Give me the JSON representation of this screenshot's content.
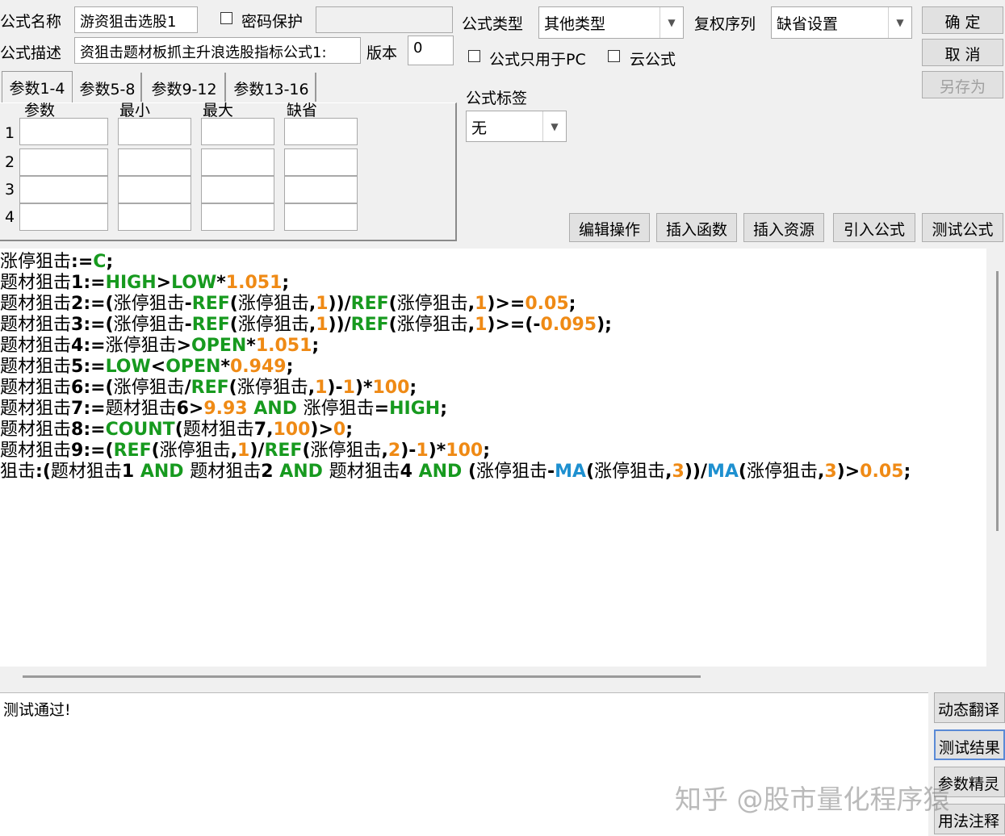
{
  "top": {
    "name_label": "公式名称",
    "name_value": "游资狙击选股1",
    "password_label": "密码保护",
    "desc_label": "公式描述",
    "desc_value": "资狙击题材板抓主升浪选股指标公式1:",
    "version_label": "版本",
    "version_value": "0",
    "type_label": "公式类型",
    "type_value": "其他类型",
    "fq_label": "复权序列",
    "fq_value": "缺省设置",
    "pc_only_label": "公式只用于PC",
    "cloud_label": "云公式",
    "tag_label": "公式标签",
    "tag_value": "无"
  },
  "buttons": {
    "ok": "确 定",
    "cancel": "取 消",
    "save_as": "另存为",
    "edit_ops": "编辑操作",
    "insert_func": "插入函数",
    "insert_res": "插入资源",
    "import_formula": "引入公式",
    "test_formula": "测试公式"
  },
  "params": {
    "tabs": [
      "参数1-4",
      "参数5-8",
      "参数9-12",
      "参数13-16"
    ],
    "headers": [
      "参数",
      "最小",
      "最大",
      "缺省"
    ],
    "rows": [
      "1",
      "2",
      "3",
      "4"
    ]
  },
  "code_lines": [
    [
      [
        "cn",
        "涨停狙击"
      ],
      [
        "op",
        ":="
      ],
      [
        "kf",
        "C"
      ],
      [
        "op",
        ";"
      ]
    ],
    [
      [
        "cn",
        "题材狙击"
      ],
      [
        "op",
        "1:="
      ],
      [
        "kf",
        "HIGH"
      ],
      [
        "op",
        ">"
      ],
      [
        "kf",
        "LOW"
      ],
      [
        "op",
        "*"
      ],
      [
        "n",
        "1.051"
      ],
      [
        "op",
        ";"
      ]
    ],
    [
      [
        "cn",
        "题材狙击"
      ],
      [
        "op",
        "2:=("
      ],
      [
        "cn",
        "涨停狙击"
      ],
      [
        "op",
        "-"
      ],
      [
        "kf",
        "REF"
      ],
      [
        "op",
        "("
      ],
      [
        "cn",
        "涨停狙击"
      ],
      [
        "op",
        ","
      ],
      [
        "n",
        "1"
      ],
      [
        "op",
        "))/"
      ],
      [
        "kf",
        "REF"
      ],
      [
        "op",
        "("
      ],
      [
        "cn",
        "涨停狙击"
      ],
      [
        "op",
        ","
      ],
      [
        "n",
        "1"
      ],
      [
        "op",
        ")>="
      ],
      [
        "n",
        "0.05"
      ],
      [
        "op",
        ";"
      ]
    ],
    [
      [
        "cn",
        "题材狙击"
      ],
      [
        "op",
        "3:=("
      ],
      [
        "cn",
        "涨停狙击"
      ],
      [
        "op",
        "-"
      ],
      [
        "kf",
        "REF"
      ],
      [
        "op",
        "("
      ],
      [
        "cn",
        "涨停狙击"
      ],
      [
        "op",
        ","
      ],
      [
        "n",
        "1"
      ],
      [
        "op",
        "))/"
      ],
      [
        "kf",
        "REF"
      ],
      [
        "op",
        "("
      ],
      [
        "cn",
        "涨停狙击"
      ],
      [
        "op",
        ","
      ],
      [
        "n",
        "1"
      ],
      [
        "op",
        ")>=(-"
      ],
      [
        "n",
        "0.095"
      ],
      [
        "op",
        ");"
      ]
    ],
    [
      [
        "cn",
        "题材狙击"
      ],
      [
        "op",
        "4:="
      ],
      [
        "cn",
        "涨停狙击"
      ],
      [
        "op",
        ">"
      ],
      [
        "kf",
        "OPEN"
      ],
      [
        "op",
        "*"
      ],
      [
        "n",
        "1.051"
      ],
      [
        "op",
        ";"
      ]
    ],
    [
      [
        "cn",
        "题材狙击"
      ],
      [
        "op",
        "5:="
      ],
      [
        "kf",
        "LOW"
      ],
      [
        "op",
        "<"
      ],
      [
        "kf",
        "OPEN"
      ],
      [
        "op",
        "*"
      ],
      [
        "n",
        "0.949"
      ],
      [
        "op",
        ";"
      ]
    ],
    [
      [
        "cn",
        "题材狙击"
      ],
      [
        "op",
        "6:=("
      ],
      [
        "cn",
        "涨停狙击"
      ],
      [
        "op",
        "/"
      ],
      [
        "kf",
        "REF"
      ],
      [
        "op",
        "("
      ],
      [
        "cn",
        "涨停狙击"
      ],
      [
        "op",
        ","
      ],
      [
        "n",
        "1"
      ],
      [
        "op",
        ")-"
      ],
      [
        "n",
        "1"
      ],
      [
        "op",
        ")*"
      ],
      [
        "n",
        "100"
      ],
      [
        "op",
        ";"
      ]
    ],
    [
      [
        "cn",
        "题材狙击"
      ],
      [
        "op",
        "7:="
      ],
      [
        "cn",
        "题材狙击"
      ],
      [
        "op",
        "6>"
      ],
      [
        "n",
        "9.93"
      ],
      [
        "op",
        " "
      ],
      [
        "kf",
        "AND"
      ],
      [
        "op",
        " "
      ],
      [
        "cn",
        "涨停狙击"
      ],
      [
        "op",
        "="
      ],
      [
        "kf",
        "HIGH"
      ],
      [
        "op",
        ";"
      ]
    ],
    [
      [
        "cn",
        "题材狙击"
      ],
      [
        "op",
        "8:="
      ],
      [
        "kf",
        "COUNT"
      ],
      [
        "op",
        "("
      ],
      [
        "cn",
        "题材狙击"
      ],
      [
        "op",
        "7,"
      ],
      [
        "n",
        "100"
      ],
      [
        "op",
        ")>"
      ],
      [
        "n",
        "0"
      ],
      [
        "op",
        ";"
      ]
    ],
    [
      [
        "cn",
        "题材狙击"
      ],
      [
        "op",
        "9:=("
      ],
      [
        "kf",
        "REF"
      ],
      [
        "op",
        "("
      ],
      [
        "cn",
        "涨停狙击"
      ],
      [
        "op",
        ","
      ],
      [
        "n",
        "1"
      ],
      [
        "op",
        ")/"
      ],
      [
        "kf",
        "REF"
      ],
      [
        "op",
        "("
      ],
      [
        "cn",
        "涨停狙击"
      ],
      [
        "op",
        ","
      ],
      [
        "n",
        "2"
      ],
      [
        "op",
        ")-"
      ],
      [
        "n",
        "1"
      ],
      [
        "op",
        ")*"
      ],
      [
        "n",
        "100"
      ],
      [
        "op",
        ";"
      ]
    ],
    [
      [
        "cn",
        "狙击"
      ],
      [
        "op",
        ":("
      ],
      [
        "cn",
        "题材狙击"
      ],
      [
        "op",
        "1 "
      ],
      [
        "kf",
        "AND"
      ],
      [
        "op",
        " "
      ],
      [
        "cn",
        "题材狙击"
      ],
      [
        "op",
        "2 "
      ],
      [
        "kf",
        "AND"
      ],
      [
        "op",
        " "
      ],
      [
        "cn",
        "题材狙击"
      ],
      [
        "op",
        "4 "
      ],
      [
        "kf",
        "AND"
      ],
      [
        "op",
        " ("
      ],
      [
        "cn",
        "涨停狙击"
      ],
      [
        "op",
        "-"
      ],
      [
        "ma",
        "MA"
      ],
      [
        "op",
        "("
      ],
      [
        "cn",
        "涨停狙击"
      ],
      [
        "op",
        ","
      ],
      [
        "n",
        "3"
      ],
      [
        "op",
        "))/"
      ],
      [
        "ma",
        "MA"
      ],
      [
        "op",
        "("
      ],
      [
        "cn",
        "涨停狙击"
      ],
      [
        "op",
        ","
      ],
      [
        "n",
        "3"
      ],
      [
        "op",
        ")>"
      ],
      [
        "n",
        "0.05"
      ],
      [
        "op",
        ";"
      ]
    ]
  ],
  "output": {
    "text": "测试通过!"
  },
  "side_buttons": {
    "dyn_translate": "动态翻译",
    "test_result": "测试结果",
    "param_wizard": "参数精灵",
    "usage": "用法注释"
  },
  "watermark": "知乎 @股市量化程序猿",
  "colors": {
    "keyword": "#179a1f",
    "number": "#ef8a15",
    "ma_func": "#1e90d0"
  }
}
